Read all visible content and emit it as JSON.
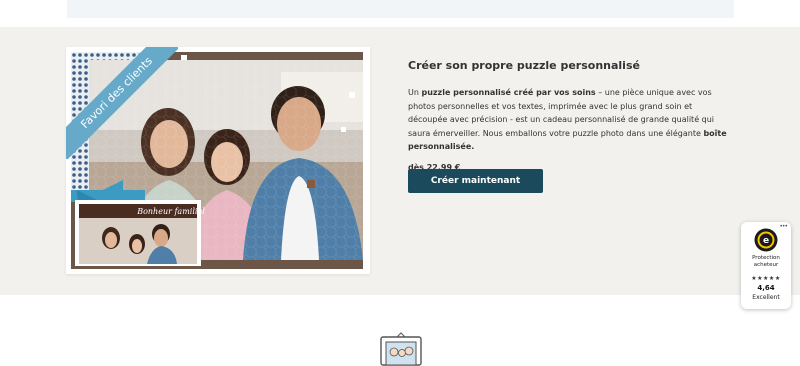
{
  "ribbon": {
    "label": "Favori des clients"
  },
  "product": {
    "heading": "Créer son propre puzzle personnalisé",
    "desc_1": "Un ",
    "desc_bold_1": "puzzle personnalisé créé par vos soins",
    "desc_2": " – une pièce unique avec vos photos personnelles et vos textes, imprimée avec le plus grand soin et découpée avec précision - est un cadeau personnalisé de grande qualité qui saura émerveiller. Nous emballons votre puzzle photo dans une élégante ",
    "desc_bold_2": "boîte personnalisée.",
    "price": "dès 22,99 €",
    "cta_label": "Créer maintenant"
  },
  "inset_photo": {
    "caption": "Bonheur familial"
  },
  "trust_badge": {
    "label_line1": "Protection",
    "label_line2": "acheteur",
    "stars": "★★★★★",
    "rating": 4.64,
    "score": "4,64",
    "grade": "Excellent",
    "menu_icon": "dots-icon"
  },
  "colors": {
    "band_bg": "#f3f1ee",
    "cta_bg": "#1b4a5d",
    "ribbon": "#67a9c8",
    "top_box": "#f1f5f8"
  }
}
